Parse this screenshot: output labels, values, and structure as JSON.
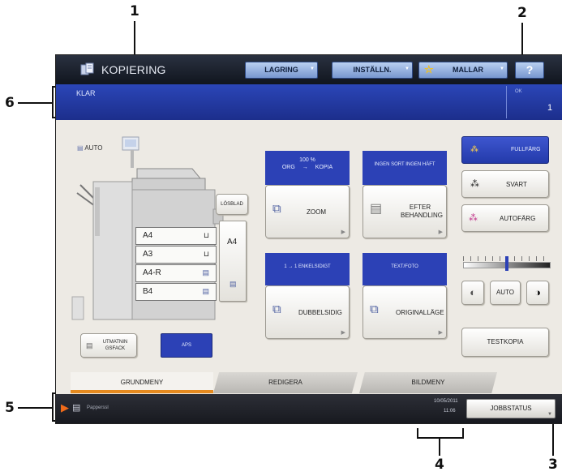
{
  "callouts": [
    "1",
    "2",
    "3",
    "4",
    "5",
    "6"
  ],
  "header": {
    "title": "KOPIERING",
    "buttons": {
      "storage": "LAGRING",
      "settings": "INSTÄLLN.",
      "templates": "MALLAR",
      "help": "?"
    }
  },
  "status": {
    "message": "KLAR",
    "copies_label": "OK",
    "copies_value": "1"
  },
  "left": {
    "auto_label": "AUTO",
    "bypass_label": "LÖSBLAD",
    "bypass_paper": "A4",
    "trays": [
      {
        "label": "A4",
        "icon": "⊔"
      },
      {
        "label": "A3",
        "icon": "⊔"
      },
      {
        "label": "A4-R",
        "icon": "▤"
      },
      {
        "label": "B4",
        "icon": "▤"
      }
    ],
    "output_tray": "UTMATNIN GSFACK",
    "aps": "APS"
  },
  "zoom": {
    "ratio_value": "100  %",
    "ratio_orig": "ORG",
    "ratio_arrow": "→",
    "ratio_copy": "KOPIA",
    "button": "ZOOM"
  },
  "finishing": {
    "panel": "INGEN SORT INGEN HÄFT",
    "button": "EFTER BEHANDLING"
  },
  "duplex": {
    "panel": "1 → 1 ENKELSIDIGT",
    "button": "DUBBELSIDIG"
  },
  "original": {
    "panel": "TEXT/FOTO",
    "button": "ORIGINALLÄGE"
  },
  "color": {
    "full": "FULLFÄRG",
    "black": "SVART",
    "auto": "AUTOFÄRG"
  },
  "density": {
    "auto": "AUTO",
    "level": 0.5
  },
  "test_copy": "TESTKOPIA",
  "tabs": [
    "GRUNDMENY",
    "REDIGERA",
    "BILDMENY"
  ],
  "footer": {
    "message": "Papperssl",
    "date": "10/05/2011",
    "time": "11:06",
    "job_status": "JOBBSTATUS"
  },
  "colors": {
    "title_bar": "#10151e",
    "status_bar": "#1c2e8c",
    "accent_orange": "#e58a1f",
    "blue_button": "#2c41b6"
  }
}
